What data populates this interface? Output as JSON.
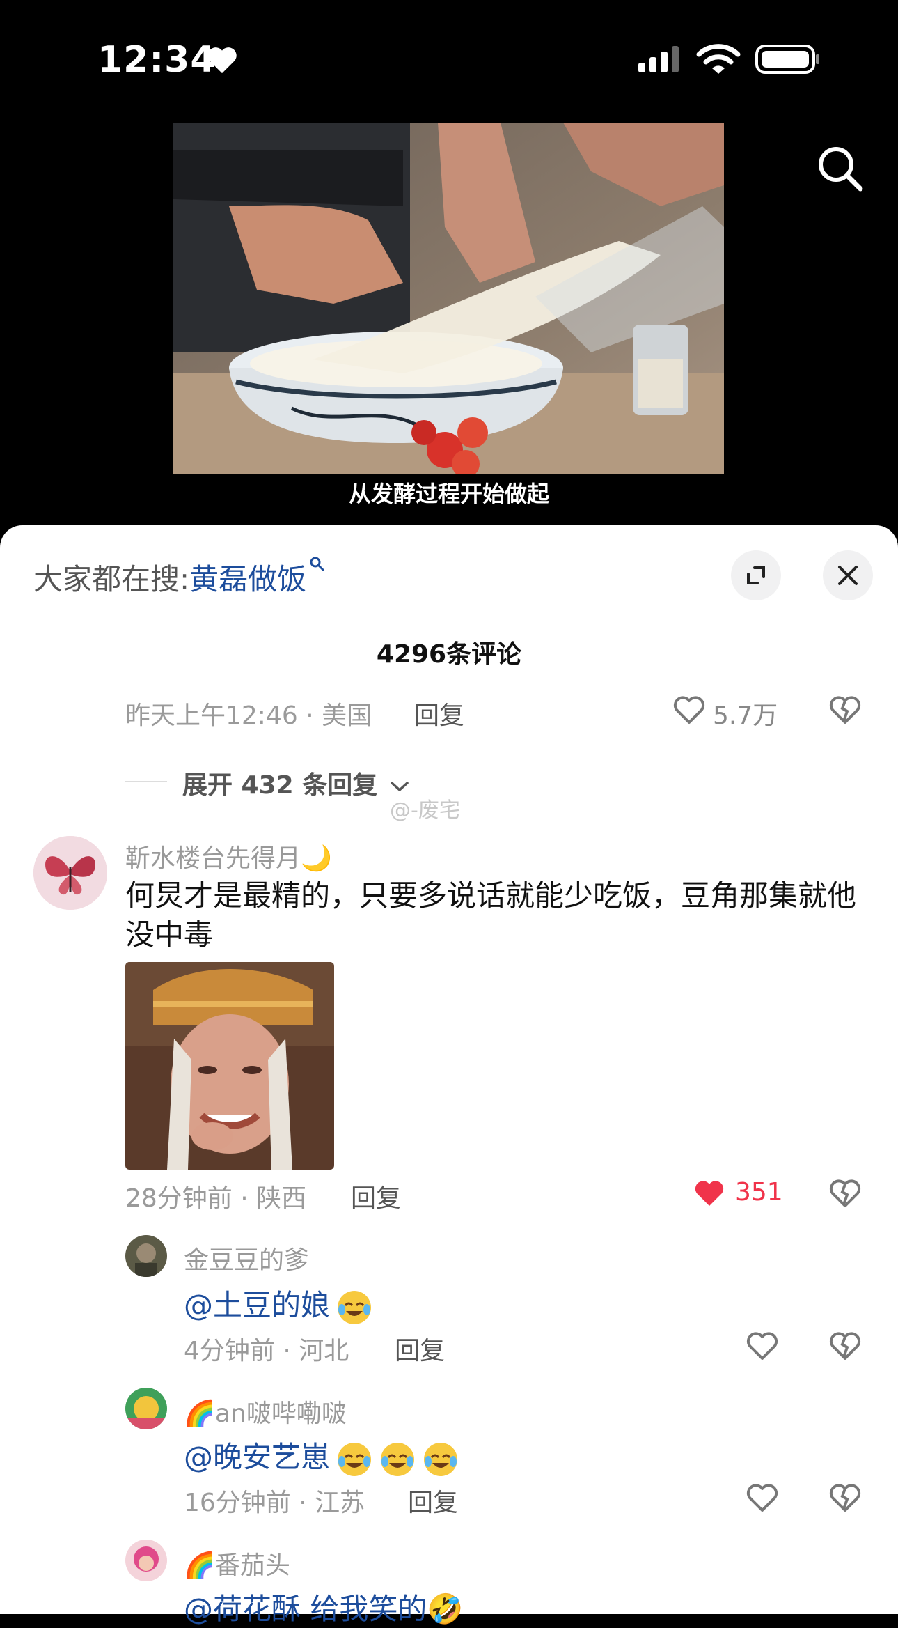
{
  "status_bar": {
    "time": "12:34"
  },
  "video": {
    "subtitle": "从发酵过程开始做起"
  },
  "sheet": {
    "everyone_searching_label": "大家都在搜:",
    "everyone_searching_link": "黄磊做饭",
    "comment_count": "4296条评论"
  },
  "top_comment_meta": {
    "meta": "昨天上午12:46 · 美国",
    "reply": "回复",
    "like_count": "5.7万"
  },
  "expand": {
    "label": "展开 432 条回复"
  },
  "watermark": "@-废宅",
  "comment": {
    "username": "靳水楼台先得月🌙",
    "text": "何炅才是最精的，只要多说话就能少吃饭，豆角那集就他没中毒",
    "meta": "28分钟前 · 陕西",
    "reply": "回复",
    "like_count": "351",
    "liked": true
  },
  "replies": [
    {
      "username": "金豆豆的爹",
      "mention": "@土豆的娘",
      "meta": "4分钟前 · 河北",
      "reply": "回复"
    },
    {
      "username": "🌈an啵哔嘞啵",
      "mention": "@晚安艺崽",
      "meta": "16分钟前 · 江苏",
      "reply": "回复"
    },
    {
      "username": "🌈番茄头",
      "mention": "@荷花酥 给我笑的🤣"
    }
  ],
  "colors": {
    "accent_link": "#1d4d9c",
    "like_red": "#f0334a"
  }
}
